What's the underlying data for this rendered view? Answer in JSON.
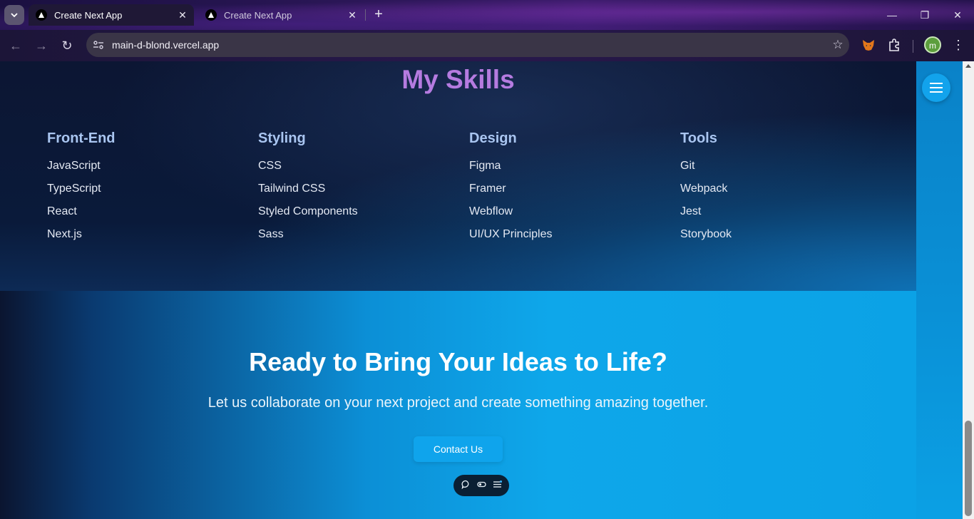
{
  "browser": {
    "tabs": [
      {
        "title": "Create Next App",
        "active": true
      },
      {
        "title": "Create Next App",
        "active": false
      }
    ],
    "url": "main-d-blond.vercel.app",
    "profile_initial": "m"
  },
  "skills": {
    "title": "My Skills",
    "categories": [
      {
        "name": "Front-End",
        "items": [
          "JavaScript",
          "TypeScript",
          "React",
          "Next.js"
        ]
      },
      {
        "name": "Styling",
        "items": [
          "CSS",
          "Tailwind CSS",
          "Styled Components",
          "Sass"
        ]
      },
      {
        "name": "Design",
        "items": [
          "Figma",
          "Framer",
          "Webflow",
          "UI/UX Principles"
        ]
      },
      {
        "name": "Tools",
        "items": [
          "Git",
          "Webpack",
          "Jest",
          "Storybook"
        ]
      }
    ]
  },
  "cta": {
    "title": "Ready to Bring Your Ideas to Life?",
    "subtitle": "Let us collaborate on your next project and create something amazing together.",
    "button_label": "Contact Us"
  },
  "colors": {
    "skills_title": "#b57be0",
    "category_heading": "#a9c5f0",
    "cta_blue": "#0fa4ec"
  }
}
